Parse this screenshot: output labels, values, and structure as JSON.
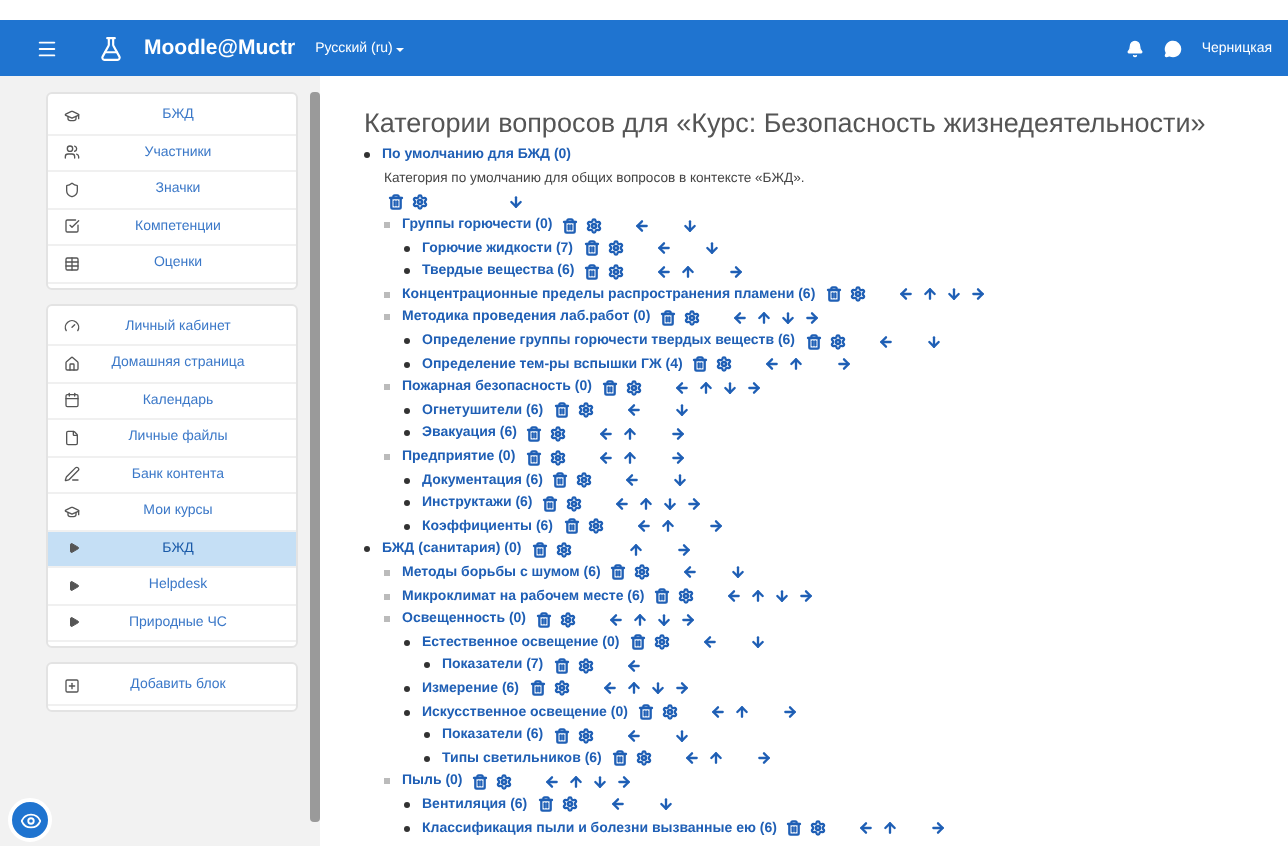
{
  "navbar": {
    "site_name": "Moodle@Muctr",
    "language": "Русский (ru)",
    "user": "Черницкая"
  },
  "sidebar": {
    "blocks": [
      {
        "items": [
          {
            "label": "БЖД",
            "selected": false
          },
          {
            "label": "Участники",
            "selected": false
          },
          {
            "label": "Значки",
            "selected": false
          },
          {
            "label": "Компетенции",
            "selected": false
          },
          {
            "label": "Оценки",
            "selected": false
          }
        ]
      },
      {
        "items": [
          {
            "label": "Личный кабинет",
            "selected": false
          },
          {
            "label": "Домашняя страница",
            "selected": false
          },
          {
            "label": "Календарь",
            "selected": false
          },
          {
            "label": "Личные файлы",
            "selected": false
          },
          {
            "label": "Банк контента",
            "selected": false
          },
          {
            "label": "Мои курсы",
            "selected": false,
            "children": [
              {
                "label": "БЖД",
                "selected": true
              },
              {
                "label": "Helpdesk",
                "selected": false
              },
              {
                "label": "Природные ЧС",
                "selected": false
              }
            ]
          }
        ]
      },
      {
        "items": [
          {
            "label": "Добавить блок",
            "selected": false
          }
        ]
      }
    ]
  },
  "page_title": "Категории вопросов для «Курс: Безопасность жизнедеятельности»",
  "categories": [
    {
      "label": "По умолчанию для БЖД (0)",
      "description": "Категория по умолчанию для общих вопросов в контексте «БЖД».",
      "actions": [
        {
          "kind": "delete"
        },
        {
          "kind": "edit"
        },
        {
          "kind": "down"
        }
      ],
      "children": [
        {
          "label": "Группы горючести (0)",
          "actions": [
            {
              "kind": "delete"
            },
            {
              "kind": "edit"
            },
            {
              "kind": "left"
            },
            {
              "kind": "down"
            }
          ],
          "children": [
            {
              "label": "Горючие жидкости (7)",
              "actions": [
                {
                  "kind": "delete"
                },
                {
                  "kind": "edit"
                },
                {
                  "kind": "left"
                },
                {
                  "kind": "down"
                }
              ]
            },
            {
              "label": "Твердые вещества (6)",
              "actions": [
                {
                  "kind": "delete"
                },
                {
                  "kind": "edit"
                },
                {
                  "kind": "left"
                },
                {
                  "kind": "up"
                },
                {
                  "kind": "right"
                }
              ]
            }
          ]
        },
        {
          "label": "Концентрационные пределы распространения пламени (6)",
          "actions": [
            {
              "kind": "delete"
            },
            {
              "kind": "edit"
            },
            {
              "kind": "left"
            },
            {
              "kind": "up"
            },
            {
              "kind": "down"
            },
            {
              "kind": "right"
            }
          ]
        },
        {
          "label": "Методика проведения лаб.работ (0)",
          "actions": [
            {
              "kind": "delete"
            },
            {
              "kind": "edit"
            },
            {
              "kind": "left"
            },
            {
              "kind": "up"
            },
            {
              "kind": "down"
            },
            {
              "kind": "right"
            }
          ],
          "children": [
            {
              "label": "Определение группы горючести твердых веществ (6)",
              "actions": [
                {
                  "kind": "delete"
                },
                {
                  "kind": "edit"
                },
                {
                  "kind": "left"
                },
                {
                  "kind": "down"
                }
              ]
            },
            {
              "label": "Определение тем-ры вспышки ГЖ (4)",
              "actions": [
                {
                  "kind": "delete"
                },
                {
                  "kind": "edit"
                },
                {
                  "kind": "left"
                },
                {
                  "kind": "up"
                },
                {
                  "kind": "right"
                }
              ]
            }
          ]
        },
        {
          "label": "Пожарная безопасность (0)",
          "actions": [
            {
              "kind": "delete"
            },
            {
              "kind": "edit"
            },
            {
              "kind": "left"
            },
            {
              "kind": "up"
            },
            {
              "kind": "down"
            },
            {
              "kind": "right"
            }
          ],
          "children": [
            {
              "label": "Огнетушители (6)",
              "actions": [
                {
                  "kind": "delete"
                },
                {
                  "kind": "edit"
                },
                {
                  "kind": "left"
                },
                {
                  "kind": "down"
                }
              ]
            },
            {
              "label": "Эвакуация (6)",
              "actions": [
                {
                  "kind": "delete"
                },
                {
                  "kind": "edit"
                },
                {
                  "kind": "left"
                },
                {
                  "kind": "up"
                },
                {
                  "kind": "right"
                }
              ]
            }
          ]
        },
        {
          "label": "Предприятие (0)",
          "actions": [
            {
              "kind": "delete"
            },
            {
              "kind": "edit"
            },
            {
              "kind": "left"
            },
            {
              "kind": "up"
            },
            {
              "kind": "right"
            }
          ],
          "children": [
            {
              "label": "Документация (6)",
              "actions": [
                {
                  "kind": "delete"
                },
                {
                  "kind": "edit"
                },
                {
                  "kind": "left"
                },
                {
                  "kind": "down"
                }
              ]
            },
            {
              "label": "Инструктажи (6)",
              "actions": [
                {
                  "kind": "delete"
                },
                {
                  "kind": "edit"
                },
                {
                  "kind": "left"
                },
                {
                  "kind": "up"
                },
                {
                  "kind": "down"
                },
                {
                  "kind": "right"
                }
              ]
            },
            {
              "label": "Коэффициенты (6)",
              "actions": [
                {
                  "kind": "delete"
                },
                {
                  "kind": "edit"
                },
                {
                  "kind": "left"
                },
                {
                  "kind": "up"
                },
                {
                  "kind": "right"
                }
              ]
            }
          ]
        }
      ]
    },
    {
      "label": "БЖД (санитария) (0)",
      "actions": [
        {
          "kind": "delete"
        },
        {
          "kind": "edit"
        },
        {
          "kind": "up"
        },
        {
          "kind": "right"
        }
      ],
      "children": [
        {
          "label": "Методы борьбы с шумом (6)",
          "actions": [
            {
              "kind": "delete"
            },
            {
              "kind": "edit"
            },
            {
              "kind": "left"
            },
            {
              "kind": "down"
            }
          ]
        },
        {
          "label": "Микроклимат на рабочем месте (6)",
          "actions": [
            {
              "kind": "delete"
            },
            {
              "kind": "edit"
            },
            {
              "kind": "left"
            },
            {
              "kind": "up"
            },
            {
              "kind": "down"
            },
            {
              "kind": "right"
            }
          ]
        },
        {
          "label": "Освещенность (0)",
          "actions": [
            {
              "kind": "delete"
            },
            {
              "kind": "edit"
            },
            {
              "kind": "left"
            },
            {
              "kind": "up"
            },
            {
              "kind": "down"
            },
            {
              "kind": "right"
            }
          ],
          "children": [
            {
              "label": "Естественное освещение (0)",
              "actions": [
                {
                  "kind": "delete"
                },
                {
                  "kind": "edit"
                },
                {
                  "kind": "left"
                },
                {
                  "kind": "down"
                }
              ],
              "children": [
                {
                  "label": "Показатели (7)",
                  "actions": [
                    {
                      "kind": "delete"
                    },
                    {
                      "kind": "edit"
                    },
                    {
                      "kind": "left"
                    }
                  ]
                }
              ]
            },
            {
              "label": "Измерение (6)",
              "actions": [
                {
                  "kind": "delete"
                },
                {
                  "kind": "edit"
                },
                {
                  "kind": "left"
                },
                {
                  "kind": "up"
                },
                {
                  "kind": "down"
                },
                {
                  "kind": "right"
                }
              ]
            },
            {
              "label": "Искусственное освещение (0)",
              "actions": [
                {
                  "kind": "delete"
                },
                {
                  "kind": "edit"
                },
                {
                  "kind": "left"
                },
                {
                  "kind": "up"
                },
                {
                  "kind": "right"
                }
              ],
              "children": [
                {
                  "label": "Показатели (6)",
                  "actions": [
                    {
                      "kind": "delete"
                    },
                    {
                      "kind": "edit"
                    },
                    {
                      "kind": "left"
                    },
                    {
                      "kind": "down"
                    }
                  ]
                },
                {
                  "label": "Типы светильников (6)",
                  "actions": [
                    {
                      "kind": "delete"
                    },
                    {
                      "kind": "edit"
                    },
                    {
                      "kind": "left"
                    },
                    {
                      "kind": "up"
                    },
                    {
                      "kind": "right"
                    }
                  ]
                }
              ]
            }
          ]
        },
        {
          "label": "Пыль (0)",
          "actions": [
            {
              "kind": "delete"
            },
            {
              "kind": "edit"
            },
            {
              "kind": "left"
            },
            {
              "kind": "up"
            },
            {
              "kind": "down"
            },
            {
              "kind": "right"
            }
          ],
          "children": [
            {
              "label": "Вентиляция (6)",
              "actions": [
                {
                  "kind": "delete"
                },
                {
                  "kind": "edit"
                },
                {
                  "kind": "left"
                },
                {
                  "kind": "down"
                }
              ]
            },
            {
              "label": "Классификация пыли и болезни вызванные ею (6)",
              "actions": [
                {
                  "kind": "delete"
                },
                {
                  "kind": "edit"
                },
                {
                  "kind": "left"
                },
                {
                  "kind": "up"
                },
                {
                  "kind": "right"
                }
              ]
            }
          ]
        }
      ]
    }
  ]
}
